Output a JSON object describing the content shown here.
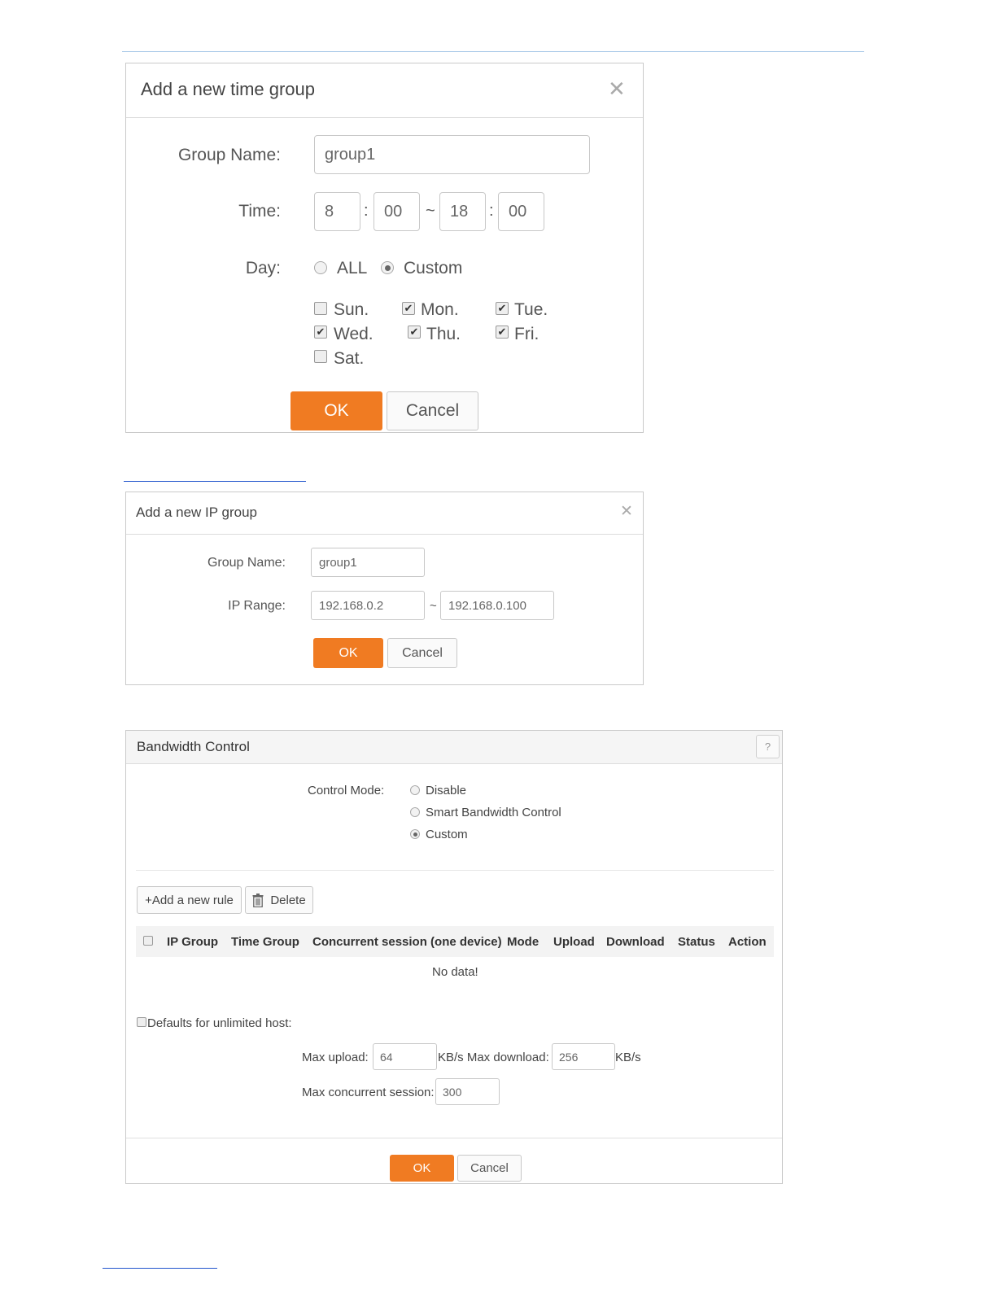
{
  "time_group_dialog": {
    "title": "Add a new time group",
    "close_icon": "close-icon",
    "group_name_label": "Group Name:",
    "group_name_value": "group1",
    "time_label": "Time:",
    "start_hour": "8",
    "start_minute": "00",
    "end_hour": "18",
    "end_minute": "00",
    "colon": ":",
    "tilde": "~",
    "day_label": "Day:",
    "day_options": [
      {
        "label": "ALL",
        "selected": false
      },
      {
        "label": "Custom",
        "selected": true
      }
    ],
    "days": [
      {
        "label": "Sun.",
        "checked": false
      },
      {
        "label": "Mon.",
        "checked": true
      },
      {
        "label": "Tue.",
        "checked": true
      },
      {
        "label": "Wed.",
        "checked": true
      },
      {
        "label": "Thu.",
        "checked": true
      },
      {
        "label": "Fri.",
        "checked": true
      },
      {
        "label": "Sat.",
        "checked": false
      }
    ],
    "ok_label": "OK",
    "cancel_label": "Cancel"
  },
  "ip_group_dialog": {
    "title": "Add a new IP group",
    "close_icon": "close-icon",
    "group_name_label": "Group Name:",
    "group_name_value": "group1",
    "ip_range_label": "IP Range:",
    "ip_start": "192.168.0.2",
    "ip_end": "192.168.0.100",
    "tilde": "~",
    "ok_label": "OK",
    "cancel_label": "Cancel"
  },
  "bandwidth_control": {
    "title": "Bandwidth Control",
    "help_label": "?",
    "control_mode_label": "Control Mode:",
    "modes": [
      {
        "label": "Disable",
        "selected": false
      },
      {
        "label": "Smart Bandwidth Control",
        "selected": false
      },
      {
        "label": "Custom",
        "selected": true
      }
    ],
    "add_rule_label": "+Add a new rule",
    "delete_label": "Delete",
    "columns": [
      "IP Group",
      "Time Group",
      "Concurrent session (one device)",
      "Mode",
      "Upload",
      "Download",
      "Status",
      "Action"
    ],
    "empty_text": "No data!",
    "defaults_label": "Defaults for unlimited host:",
    "max_upload_label": "Max upload:",
    "max_upload_value": "64",
    "upload_unit_and_download_label": "KB/s Max download:",
    "max_download_value": "256",
    "download_unit": "KB/s",
    "max_session_label": "Max concurrent session:",
    "max_session_value": "300",
    "ok_label": "OK",
    "cancel_label": "Cancel"
  },
  "colors": {
    "accent": "#f07b22",
    "rule": "#9fc3e6",
    "link": "#2255cc"
  }
}
